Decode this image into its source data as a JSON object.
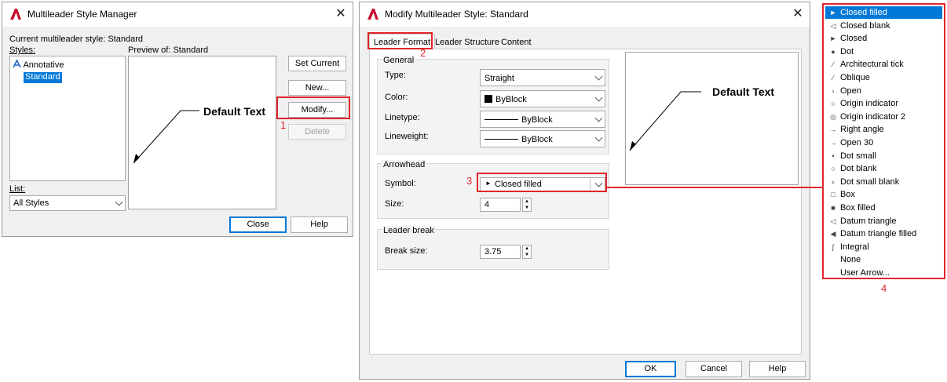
{
  "manager": {
    "title": "Multileader Style Manager",
    "close_glyph": "✕",
    "current_label": "Current multileader style: Standard",
    "styles_label": "Styles:",
    "styles": [
      "Annotative",
      "Standard"
    ],
    "preview_label": "Preview of: Standard",
    "preview_text": "Default Text",
    "list_label": "List:",
    "list_value": "All Styles",
    "buttons": {
      "set_current": "Set Current",
      "new": "New...",
      "modify": "Modify...",
      "delete": "Delete",
      "close": "Close",
      "help": "Help"
    }
  },
  "modify": {
    "title": "Modify Multileader Style: Standard",
    "close_glyph": "✕",
    "tabs": [
      "Leader Format",
      "Leader Structure",
      "Content"
    ],
    "general": {
      "label": "General",
      "type_label": "Type:",
      "type_value": "Straight",
      "color_label": "Color:",
      "color_value": "ByBlock",
      "linetype_label": "Linetype:",
      "linetype_value": "ByBlock",
      "lineweight_label": "Lineweight:",
      "lineweight_value": "ByBlock"
    },
    "arrowhead": {
      "label": "Arrowhead",
      "symbol_label": "Symbol:",
      "symbol_value": "Closed filled",
      "size_label": "Size:",
      "size_value": "4"
    },
    "leader_break": {
      "label": "Leader break",
      "break_label": "Break size:",
      "break_value": "3.75"
    },
    "preview_text": "Default Text",
    "buttons": {
      "ok": "OK",
      "cancel": "Cancel",
      "help": "Help"
    }
  },
  "arrowheads": [
    {
      "label": "Closed filled",
      "icon": "closed-filled-arrow-icon",
      "glyph": "►"
    },
    {
      "label": "Closed blank",
      "icon": "closed-blank-arrow-icon",
      "glyph": "◁"
    },
    {
      "label": "Closed",
      "icon": "closed-arrow-icon",
      "glyph": "►"
    },
    {
      "label": "Dot",
      "icon": "dot-icon",
      "glyph": "●"
    },
    {
      "label": "Architectural tick",
      "icon": "architectural-tick-icon",
      "glyph": "⁄"
    },
    {
      "label": "Oblique",
      "icon": "oblique-icon",
      "glyph": "⁄"
    },
    {
      "label": "Open",
      "icon": "open-arrow-icon",
      "glyph": "›"
    },
    {
      "label": "Origin indicator",
      "icon": "origin-indicator-icon",
      "glyph": "○"
    },
    {
      "label": "Origin indicator 2",
      "icon": "origin-indicator-2-icon",
      "glyph": "◎"
    },
    {
      "label": "Right angle",
      "icon": "right-angle-icon",
      "glyph": "→"
    },
    {
      "label": "Open 30",
      "icon": "open-30-icon",
      "glyph": "→"
    },
    {
      "label": "Dot small",
      "icon": "dot-small-icon",
      "glyph": "•"
    },
    {
      "label": "Dot blank",
      "icon": "dot-blank-icon",
      "glyph": "○"
    },
    {
      "label": "Dot small blank",
      "icon": "dot-small-blank-icon",
      "glyph": "∘"
    },
    {
      "label": "Box",
      "icon": "box-icon",
      "glyph": "□"
    },
    {
      "label": "Box filled",
      "icon": "box-filled-icon",
      "glyph": "■"
    },
    {
      "label": "Datum triangle",
      "icon": "datum-triangle-icon",
      "glyph": "◁"
    },
    {
      "label": "Datum triangle filled",
      "icon": "datum-triangle-filled-icon",
      "glyph": "◀"
    },
    {
      "label": "Integral",
      "icon": "integral-icon",
      "glyph": "∫"
    },
    {
      "label": "None",
      "icon": "",
      "glyph": ""
    },
    {
      "label": "User Arrow...",
      "icon": "",
      "glyph": ""
    }
  ],
  "callouts": [
    "1",
    "2",
    "3",
    "4"
  ],
  "colors": {
    "accent": "#0078d7",
    "callout_red": "#e0252b",
    "autocad_red": "#c8102e"
  }
}
